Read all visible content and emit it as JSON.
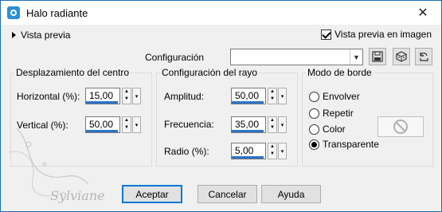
{
  "window": {
    "title": "Halo radiante",
    "close_glyph": "✕"
  },
  "preview": {
    "toggle_label": "Vista previa",
    "image_preview_label": "Vista previa en imagen",
    "image_preview_checked": true
  },
  "config": {
    "label": "Configuración",
    "value": ""
  },
  "groups": {
    "center": {
      "title": "Desplazamiento del centro",
      "horizontal": {
        "label": "Horizontal (%):",
        "value": "15,00"
      },
      "vertical": {
        "label": "Vertical (%):",
        "value": "50,00"
      }
    },
    "ray": {
      "title": "Configuración del rayo",
      "amplitude": {
        "label": "Amplitud:",
        "value": "50,00"
      },
      "frequency": {
        "label": "Frecuencia:",
        "value": "35,00"
      },
      "radius": {
        "label": "Radio (%):",
        "value": "5,00"
      }
    },
    "edge": {
      "title": "Modo de borde",
      "options": [
        {
          "label": "Envolver",
          "selected": false
        },
        {
          "label": "Repetir",
          "selected": false
        },
        {
          "label": "Color",
          "selected": false
        },
        {
          "label": "Transparente",
          "selected": true
        }
      ]
    }
  },
  "buttons": {
    "accept": "Aceptar",
    "cancel": "Cancelar",
    "help": "Ayuda"
  },
  "watermark": {
    "signature": "Sylviane"
  },
  "colors": {
    "accent": "#2a73c8",
    "title_icon": "#2a8fd6",
    "default_border": "#0078d7"
  }
}
